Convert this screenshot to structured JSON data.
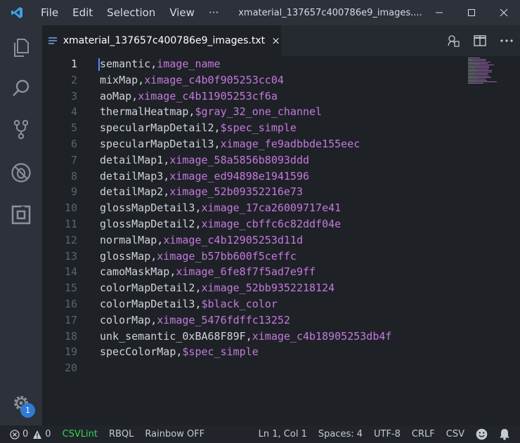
{
  "titlebar": {
    "menu": [
      "File",
      "Edit",
      "Selection",
      "View",
      "···"
    ],
    "window_title": "xmaterial_137657c400786e9_images...."
  },
  "tab": {
    "label": "xmaterial_137657c400786e9_images.txt",
    "close": "×"
  },
  "editor": {
    "active_line": 1,
    "line_numbers": [
      "1",
      "2",
      "3",
      "4",
      "5",
      "6",
      "7",
      "8",
      "9",
      "10",
      "11",
      "12",
      "13",
      "14",
      "15",
      "16",
      "17",
      "18",
      "19",
      "20"
    ],
    "lines": [
      {
        "key": "semantic,",
        "value": "image_name"
      },
      {
        "key": "mixMap,",
        "value": "ximage_c4b0f905253cc04"
      },
      {
        "key": "aoMap,",
        "value": "ximage_c4b11905253cf6a"
      },
      {
        "key": "thermalHeatmap,",
        "value": "$gray_32_one_channel"
      },
      {
        "key": "specularMapDetail2,",
        "value": "$spec_simple"
      },
      {
        "key": "specularMapDetail3,",
        "value": "ximage_fe9adbbde155eec"
      },
      {
        "key": "detailMap1,",
        "value": "ximage_58a5856b8093ddd"
      },
      {
        "key": "detailMap3,",
        "value": "ximage_ed94898e1941596"
      },
      {
        "key": "detailMap2,",
        "value": "ximage_52b09352216e73"
      },
      {
        "key": "glossMapDetail3,",
        "value": "ximage_17ca26009717e41"
      },
      {
        "key": "glossMapDetail2,",
        "value": "ximage_cbffc6c82ddf04e"
      },
      {
        "key": "normalMap,",
        "value": "ximage_c4b12905253d11d"
      },
      {
        "key": "glossMap,",
        "value": "ximage_b57bb600f5ceffc"
      },
      {
        "key": "camoMaskMap,",
        "value": "ximage_6fe8f7f5ad7e9ff"
      },
      {
        "key": "colorMapDetail2,",
        "value": "ximage_52bb9352218124"
      },
      {
        "key": "colorMapDetail3,",
        "value": "$black_color"
      },
      {
        "key": "colorMap,",
        "value": "ximage_5476fdffc13252"
      },
      {
        "key": "unk_semantic_0xBA68F89F,",
        "value": "ximage_c4b18905253db4f"
      },
      {
        "key": "specColorMap,",
        "value": "$spec_simple"
      },
      {
        "key": "",
        "value": ""
      }
    ]
  },
  "activity": {
    "badge": "1"
  },
  "statusbar": {
    "errors": "0",
    "warnings": "0",
    "csvlint": "CSVLint",
    "rbql": "RBQL",
    "rainbow": "Rainbow OFF",
    "position": "Ln 1, Col 1",
    "spaces": "Spaces: 4",
    "encoding": "UTF-8",
    "eol": "CRLF",
    "language": "CSV"
  },
  "colors": {
    "key_text": "#cfd3da",
    "value_text": "#c678dd",
    "accent": "#2f7bd5",
    "csvlint": "#39d353"
  }
}
